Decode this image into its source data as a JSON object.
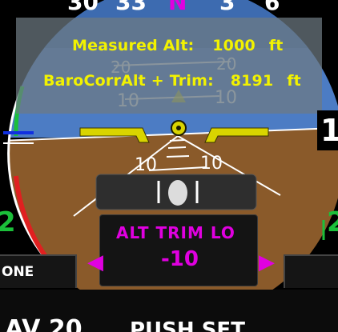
{
  "heading_tape": {
    "labels": [
      "30",
      "33",
      "N",
      "3",
      "6"
    ]
  },
  "overlay": {
    "measured_label": "Measured Alt:",
    "measured_value": "1000",
    "measured_unit": "ft",
    "baro_label": "BaroCorrAlt + Trim:",
    "baro_value": "8191",
    "baro_unit": "ft"
  },
  "pitch_ladder": {
    "up_20_left": "20",
    "up_20_right": "20",
    "up_10_left": "10",
    "up_10_right": "10",
    "down_10_left": "10",
    "down_10_right": "10"
  },
  "right_edge": {
    "digit": "1"
  },
  "side_digits": {
    "left": "2",
    "right": "2"
  },
  "trim_control": {
    "title": "ALT TRIM LO",
    "value": "-10",
    "left_arrow": "◀",
    "right_arrow": "▶"
  },
  "softkeys": {
    "left_key": "ONE",
    "bottom_left": "AV 20",
    "bottom_center": "PUSH SET"
  },
  "colors": {
    "sky": "#4c7cc4",
    "ground": "#8a5a2a",
    "symbol_yellow": "#d9d400",
    "magenta": "#e000e0",
    "panel_text": "#f2f200"
  }
}
